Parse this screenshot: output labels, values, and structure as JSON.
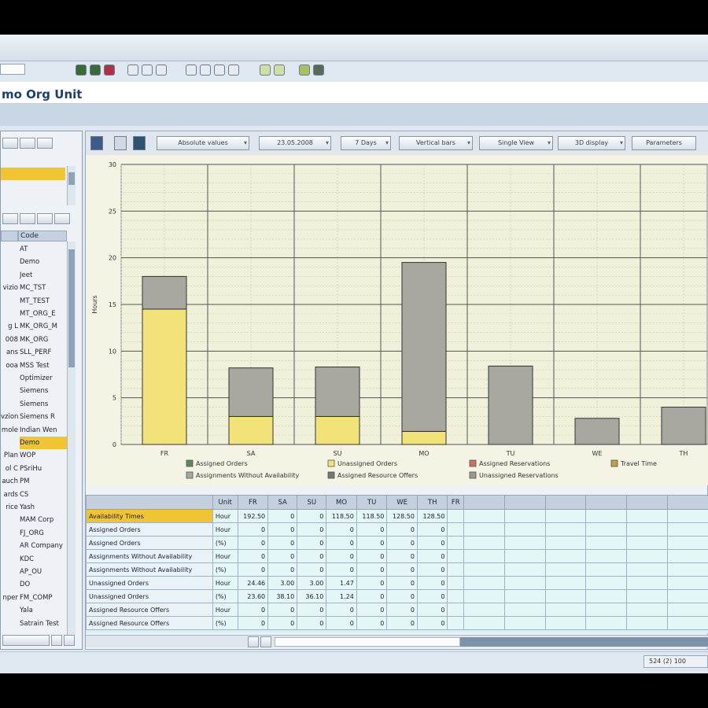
{
  "window": {
    "title": "mo Org Unit"
  },
  "left_panel": {
    "col_header": "Code",
    "rows": [
      {
        "a": "",
        "b": "AT"
      },
      {
        "a": "",
        "b": "Demo"
      },
      {
        "a": "",
        "b": "Jeet"
      },
      {
        "a": "vizio",
        "b": "MC_TST"
      },
      {
        "a": "",
        "b": "MT_TEST"
      },
      {
        "a": "",
        "b": "MT_ORG_E"
      },
      {
        "a": "g L",
        "b": "MK_ORG_M"
      },
      {
        "a": "008",
        "b": "MK_ORG"
      },
      {
        "a": "ans",
        "b": "SLL_PERF"
      },
      {
        "a": "ooa",
        "b": "MSS Test"
      },
      {
        "a": "",
        "b": "Optimizer"
      },
      {
        "a": "",
        "b": "Siemens"
      },
      {
        "a": "",
        "b": "Siemens"
      },
      {
        "a": "vzionetti",
        "b": "Siemens R"
      },
      {
        "a": "mole",
        "b": "Indian Wen"
      },
      {
        "a": "",
        "b": "Demo"
      },
      {
        "a": "Plan",
        "b": "WOP"
      },
      {
        "a": "ol C",
        "b": "PSriHu"
      },
      {
        "a": "auch",
        "b": "PM"
      },
      {
        "a": "ards",
        "b": "CS"
      },
      {
        "a": "rice",
        "b": "Yash"
      },
      {
        "a": "",
        "b": "MAM Corp"
      },
      {
        "a": "",
        "b": "FJ_ORG"
      },
      {
        "a": "",
        "b": "AR Company"
      },
      {
        "a": "",
        "b": "KDC"
      },
      {
        "a": "",
        "b": "AP_OU"
      },
      {
        "a": "",
        "b": "DO"
      },
      {
        "a": "nper",
        "b": "FM_COMP"
      },
      {
        "a": "",
        "b": "Yala"
      },
      {
        "a": "",
        "b": "Satrain Test"
      }
    ]
  },
  "chart_toolbar": {
    "buttons": [
      "Absolute values",
      "23.05.2008",
      "7 Days",
      "Vertical bars",
      "Single View",
      "3D display",
      "Parameters"
    ]
  },
  "chart_data": {
    "type": "bar",
    "categories": [
      "FR",
      "SA",
      "SU",
      "MO",
      "TU",
      "WE",
      "TH"
    ],
    "series": [
      {
        "name": "Unassigned Orders",
        "values": [
          14.5,
          3.0,
          3.0,
          1.4,
          0,
          0,
          0
        ],
        "color": "#f2e27a"
      },
      {
        "name": "Assignments Without Availability",
        "values": [
          3.5,
          5.2,
          5.3,
          18.1,
          8.4,
          2.8,
          4.0
        ],
        "color": "#a8a8a0"
      }
    ],
    "ylabel": "Hours",
    "ylim": [
      0,
      30
    ],
    "yticks": [
      0,
      5,
      10,
      15,
      20,
      25,
      30
    ],
    "legend": [
      {
        "label": "Assigned Orders",
        "color": "#5a8a5a"
      },
      {
        "label": "Unassigned Orders",
        "color": "#f2e27a"
      },
      {
        "label": "Assigned Reservations",
        "color": "#d07060"
      },
      {
        "label": "Travel Time",
        "color": "#c0a040"
      },
      {
        "label": "Assignments Without Availability",
        "color": "#a8a8a0"
      },
      {
        "label": "Assigned Resource Offers",
        "color": "#707870"
      },
      {
        "label": "Unassigned Reservations",
        "color": "#9a9a90"
      }
    ],
    "grid": true
  },
  "table": {
    "headers": [
      "",
      "Unit",
      "FR",
      "SA",
      "SU",
      "MO",
      "TU",
      "WE",
      "TH",
      "FR"
    ],
    "rows": [
      {
        "label": "Availability Times",
        "unit": "Hour",
        "v": [
          "192.50",
          "0",
          "0",
          "118.50",
          "118.50",
          "128.50",
          "128.50"
        ],
        "hl": true
      },
      {
        "label": "Assigned Orders",
        "unit": "Hour",
        "v": [
          "0",
          "0",
          "0",
          "0",
          "0",
          "0",
          "0"
        ]
      },
      {
        "label": "Assigned Orders",
        "unit": "(%)",
        "v": [
          "0",
          "0",
          "0",
          "0",
          "0",
          "0",
          "0"
        ]
      },
      {
        "label": "Assignments Without Availability",
        "unit": "Hour",
        "v": [
          "0",
          "0",
          "0",
          "0",
          "0",
          "0",
          "0"
        ]
      },
      {
        "label": "Assignments Without Availability",
        "unit": "(%)",
        "v": [
          "0",
          "0",
          "0",
          "0",
          "0",
          "0",
          "0"
        ]
      },
      {
        "label": "Unassigned Orders",
        "unit": "Hour",
        "v": [
          "24.46",
          "3.00",
          "3.00",
          "1.47",
          "0",
          "0",
          "0"
        ]
      },
      {
        "label": "Unassigned Orders",
        "unit": "(%)",
        "v": [
          "23.60",
          "38.10",
          "36.10",
          "1.24",
          "0",
          "0",
          "0"
        ]
      },
      {
        "label": "Assigned Resource Offers",
        "unit": "Hour",
        "v": [
          "0",
          "0",
          "0",
          "0",
          "0",
          "0",
          "0"
        ]
      },
      {
        "label": "Assigned Resource Offers",
        "unit": "(%)",
        "v": [
          "0",
          "0",
          "0",
          "0",
          "0",
          "0",
          "0"
        ]
      }
    ]
  },
  "status": {
    "right": "524 (2) 100"
  }
}
